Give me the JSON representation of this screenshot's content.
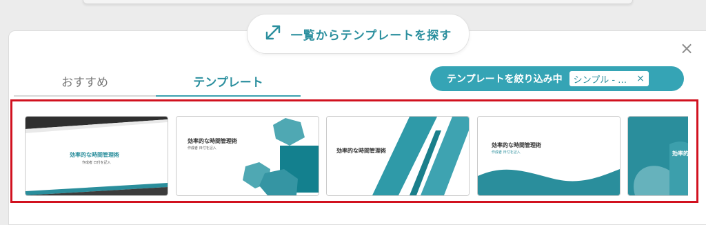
{
  "header": {
    "browse_label": "一覧からテンプレートを探す",
    "browse_icon": "expand-arrows-icon"
  },
  "tabs": [
    {
      "label": "おすすめ",
      "active": false
    },
    {
      "label": "テンプレート",
      "active": true
    }
  ],
  "filter": {
    "label": "テンプレートを絞り込み中",
    "chip_label": "シンプル - …",
    "chip_close": "×"
  },
  "close_glyph": "×",
  "cards": [
    {
      "title": "効率的な時間管理術",
      "subtitle": "作成者 日付を記入"
    },
    {
      "title": "効率的な時間管理術",
      "subtitle": "作成者 日付を記入"
    },
    {
      "title": "効率的な時間管理術"
    },
    {
      "title": "効率的な時間管理術",
      "subtitle": "作成者 日付を記入"
    },
    {
      "title": "効率的"
    }
  ],
  "colors": {
    "accent": "#35a4b5",
    "teal_dark": "#13808e",
    "highlight": "#d1111f"
  }
}
